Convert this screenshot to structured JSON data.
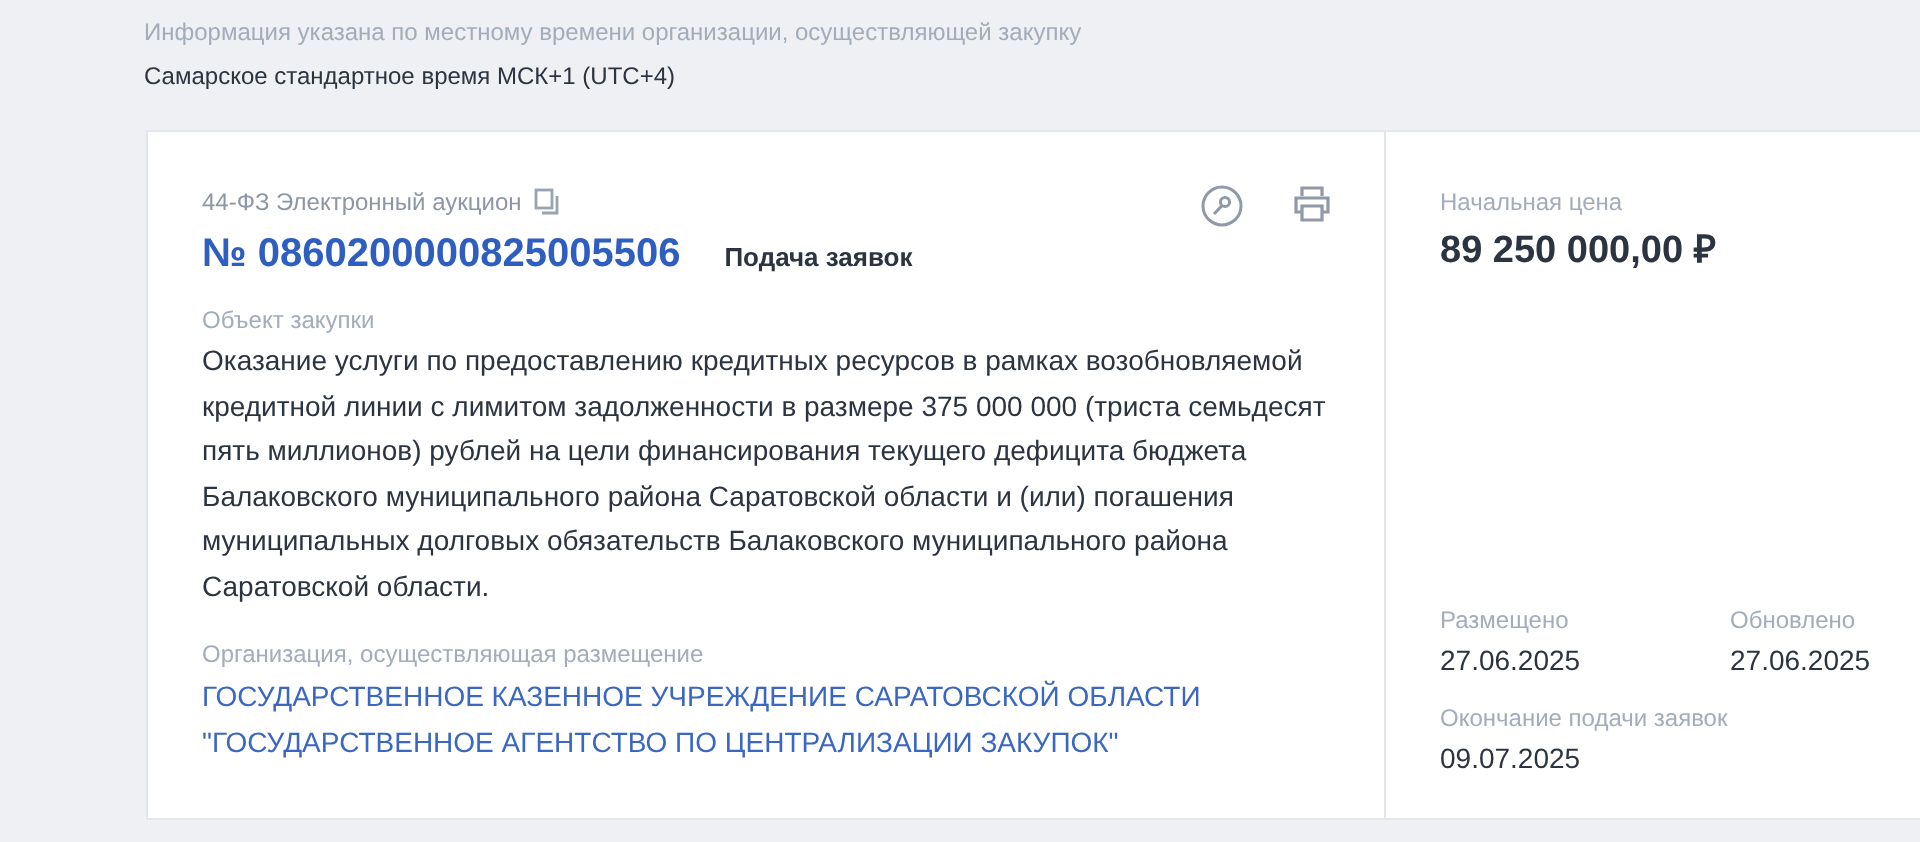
{
  "timezone_note": {
    "label": "Информация указана по местному времени организации, осуществляющей закупку",
    "value": "Самарское стандартное время МСК+1 (UTC+4)"
  },
  "card": {
    "law": "44-ФЗ",
    "method": "Электронный аукцион",
    "number": "№ 0860200000825005506",
    "stage": "Подача заявок",
    "object_label": "Объект закупки",
    "object": "Оказание услуги по предоставлению кредитных ресурсов в рамках возобновляемой кредитной линии с лимитом задолженности в размере 375 000 000 (триста семьдесят пять миллионов) рублей на цели финансирования текущего дефицита бюджета Балаковского муниципального района Саратовской области и (или) погашения муниципальных долговых обязательств Балаковского муниципального района Саратовской области.",
    "organization_label": "Организация, осуществляющая размещение",
    "organization": "ГОСУДАРСТВЕННОЕ КАЗЕННОЕ УЧРЕЖДЕНИЕ САРАТОВСКОЙ ОБЛАСТИ \"ГОСУДАРСТВЕННОЕ АГЕНТСТВО ПО ЦЕНТРАЛИЗАЦИИ ЗАКУПОК\""
  },
  "price": {
    "label": "Начальная цена",
    "value": "89 250 000,00 ₽"
  },
  "dates": [
    {
      "label": "Размещено",
      "value": "27.06.2025"
    },
    {
      "label": "Обновлено",
      "value": "27.06.2025"
    },
    {
      "label": "Окончание подачи заявок",
      "value": "09.07.2025"
    }
  ]
}
